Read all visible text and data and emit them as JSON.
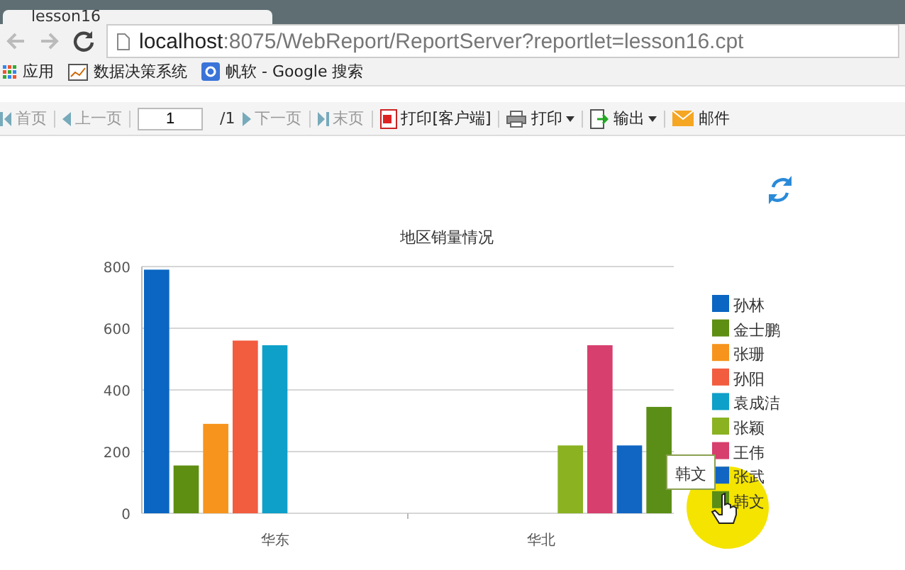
{
  "tab": {
    "title": "lesson16"
  },
  "address": {
    "host": "localhost",
    "path": ":8075/WebReport/ReportServer?reportlet=lesson16.cpt"
  },
  "bookmarks": [
    {
      "label": "应用",
      "kind": "apps"
    },
    {
      "label": "数据决策系统",
      "kind": "chart"
    },
    {
      "label": "帆软 - Google 搜索",
      "kind": "google"
    }
  ],
  "toolbar": [
    {
      "kind": "first",
      "label": "首页",
      "disabled": true
    },
    {
      "kind": "prev",
      "label": "上一页",
      "disabled": true
    },
    {
      "kind": "page",
      "value": "1",
      "total": "/1"
    },
    {
      "kind": "next",
      "label": "下一页",
      "disabled": true
    },
    {
      "kind": "last",
      "label": "末页",
      "disabled": true
    },
    {
      "kind": "pdf",
      "label": "打印[客户端]",
      "dropdown": false
    },
    {
      "kind": "printer",
      "label": "打印",
      "dropdown": true
    },
    {
      "kind": "export",
      "label": "输出",
      "dropdown": true
    },
    {
      "kind": "mail",
      "label": "邮件",
      "dropdown": false
    }
  ],
  "chart_data": {
    "type": "bar",
    "title": "地区销量情况",
    "grid": true,
    "legend": "right",
    "categories": [
      "华东",
      "华北"
    ],
    "ylim": [
      0,
      800
    ],
    "yticks": [
      0,
      200,
      400,
      600,
      800
    ],
    "series": [
      {
        "name": "孙林",
        "color": "#0a66c2",
        "values": [
          790,
          null
        ]
      },
      {
        "name": "金士鹏",
        "color": "#5e8e12",
        "values": [
          155,
          null
        ]
      },
      {
        "name": "张珊",
        "color": "#f7941d",
        "values": [
          290,
          null
        ]
      },
      {
        "name": "孙阳",
        "color": "#f25c3f",
        "values": [
          560,
          null
        ]
      },
      {
        "name": "袁成洁",
        "color": "#0ea0c8",
        "values": [
          545,
          null
        ]
      },
      {
        "name": "张颖",
        "color": "#8ab221",
        "values": [
          null,
          220
        ]
      },
      {
        "name": "王伟",
        "color": "#d63f6e",
        "values": [
          null,
          545
        ]
      },
      {
        "name": "张武",
        "color": "#1166c4",
        "values": [
          null,
          220
        ]
      },
      {
        "name": "韩文",
        "color": "#5b8e16",
        "values": [
          null,
          345
        ]
      }
    ]
  },
  "tooltip": {
    "text": "韩文"
  }
}
